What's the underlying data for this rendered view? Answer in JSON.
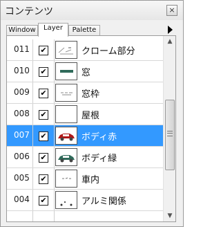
{
  "window": {
    "title": "コンテンツ",
    "close_glyph": "×"
  },
  "tabs": [
    {
      "label": "Window",
      "active": false
    },
    {
      "label": "Layer",
      "active": true
    },
    {
      "label": "Palette",
      "active": false
    }
  ],
  "layers": [
    {
      "num": "011",
      "name": "クローム部分",
      "checked": true,
      "selected": false,
      "thumb": "chrome"
    },
    {
      "num": "010",
      "name": "窓",
      "checked": true,
      "selected": false,
      "thumb": "window"
    },
    {
      "num": "009",
      "name": "窓枠",
      "checked": true,
      "selected": false,
      "thumb": "frame"
    },
    {
      "num": "008",
      "name": "屋根",
      "checked": true,
      "selected": false,
      "thumb": "blank"
    },
    {
      "num": "007",
      "name": "ボディ赤",
      "checked": true,
      "selected": true,
      "thumb": "car-red"
    },
    {
      "num": "006",
      "name": "ボディ緑",
      "checked": true,
      "selected": false,
      "thumb": "car-green"
    },
    {
      "num": "005",
      "name": "車内",
      "checked": true,
      "selected": false,
      "thumb": "interior"
    },
    {
      "num": "004",
      "name": "アルミ関係",
      "checked": true,
      "selected": false,
      "thumb": "aluminum"
    }
  ],
  "colors": {
    "selection": "#3399ff",
    "car_red": "#b01818",
    "car_green": "#2f6a5a"
  }
}
